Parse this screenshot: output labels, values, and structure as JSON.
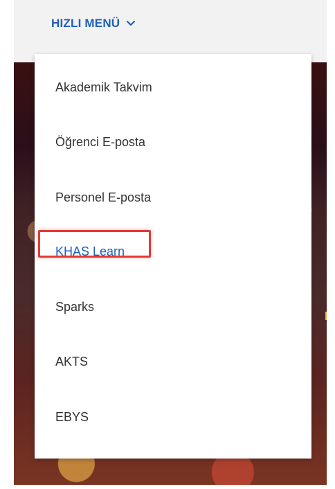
{
  "header": {
    "quick_menu_label": "HIZLI MENÜ",
    "accent_color": "#1f5fb8"
  },
  "menu": {
    "items": [
      {
        "label": "Akademik Takvim"
      },
      {
        "label": "Öğrenci E-posta"
      },
      {
        "label": "Personel E-posta"
      },
      {
        "label": "KHAS Learn",
        "highlighted": true
      },
      {
        "label": "Sparks"
      },
      {
        "label": "AKTS"
      },
      {
        "label": "EBYS"
      }
    ]
  },
  "highlight": {
    "color": "#e53935",
    "target": "KHAS Learn"
  }
}
